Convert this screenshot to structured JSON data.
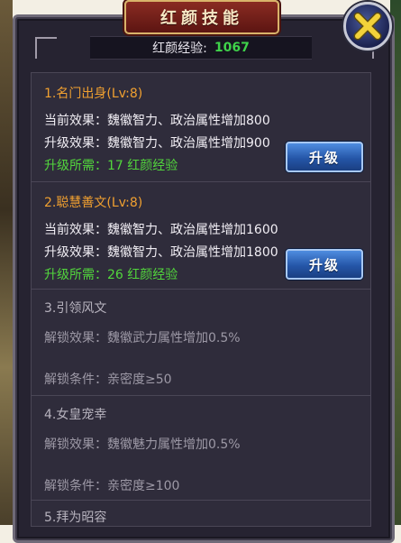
{
  "title": "红颜技能",
  "close_icon": "close-x-icon",
  "exp": {
    "label": "红颜经验:",
    "value": "1067"
  },
  "skills": [
    {
      "title": "1.名门出身(Lv:8)",
      "current": "当前效果：魏徽智力、政治属性增加800",
      "next": "升级效果：魏徽智力、政治属性增加900",
      "cost": "升级所需：17 红颜经验",
      "button": "升级"
    },
    {
      "title": "2.聪慧善文(Lv:8)",
      "current": "当前效果：魏徽智力、政治属性增加1600",
      "next": "升级效果：魏徽智力、政治属性增加1800",
      "cost": "升级所需：26 红颜经验",
      "button": "升级"
    },
    {
      "title": "3.引领风文",
      "unlock_effect": "解锁效果：魏徽武力属性增加0.5%",
      "unlock_cond": "解锁条件：亲密度≥50"
    },
    {
      "title": "4.女皇宠幸",
      "unlock_effect": "解锁效果：魏徽魅力属性增加0.5%",
      "unlock_cond": "解锁条件：亲密度≥100"
    },
    {
      "title": "5.拜为昭容"
    }
  ],
  "colors": {
    "accent_orange": "#f0a030",
    "exp_green": "#3fd24a",
    "cost_green": "#52d63c"
  }
}
